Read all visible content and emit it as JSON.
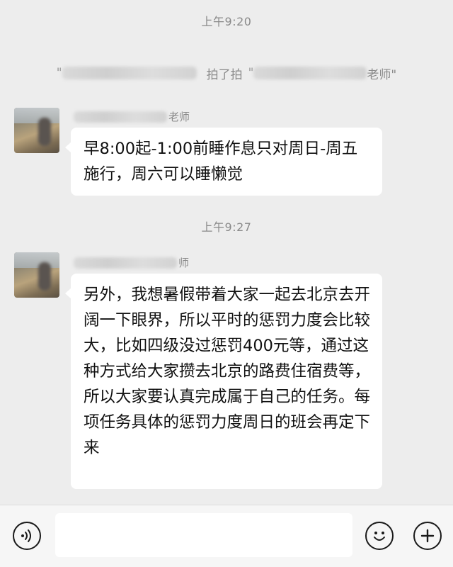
{
  "conversation": {
    "timestamps": [
      "上午9:20",
      "上午9:27"
    ],
    "pat_notice": {
      "text": "拍了拍",
      "target_suffix": "老师\""
    },
    "messages": [
      {
        "sender_suffix": "老师",
        "text": "早8:00起-1:00前睡作息只对周日-周五施行，周六可以睡懒觉"
      },
      {
        "sender_suffix": "师",
        "text": "另外，我想暑假带着大家一起去北京去开阔一下眼界，所以平时的惩罚力度会比较大，比如四级没过惩罚400元等，通过这种方式给大家攒去北京的路费住宿费等，所以大家要认真完成属于自己的任务。每项任务具体的惩罚力度周日的班会再定下来"
      }
    ]
  },
  "input_bar": {
    "voice_icon": "voice-icon",
    "emoji_icon": "emoji-icon",
    "plus_icon": "plus-icon",
    "text_value": ""
  }
}
